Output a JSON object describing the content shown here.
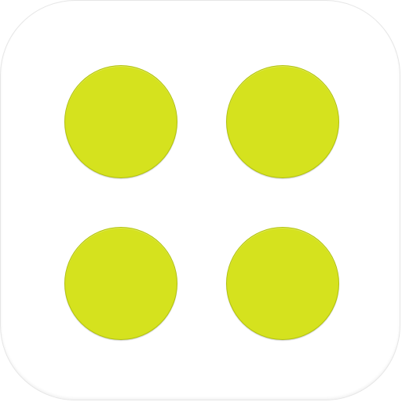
{
  "icon": {
    "name": "four-dots-app-icon",
    "background_color": "#ffffff",
    "dot_color": "#d5e21e",
    "dot_count": 4
  }
}
